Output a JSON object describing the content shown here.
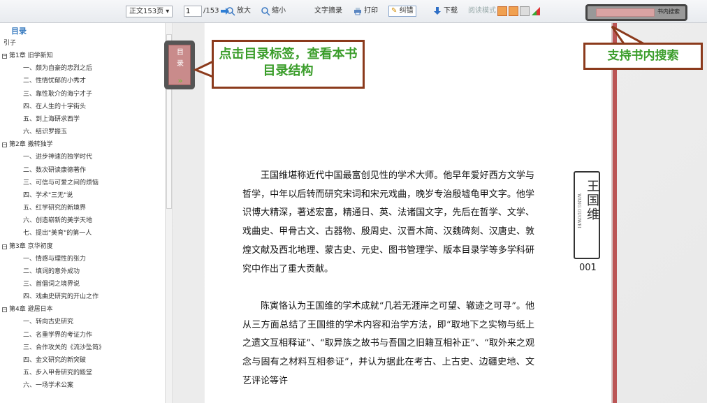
{
  "toolbar": {
    "view_select": "正文153页",
    "page_input": "1",
    "page_total": "/153",
    "zoom_in": "放大",
    "zoom_out": "缩小",
    "text_excerpt": "文字摘录",
    "print": "打印",
    "correct": "纠错",
    "download": "下载",
    "read_mode": "阅读模式",
    "search_button": "书内搜索"
  },
  "sidebar": {
    "title": "目录",
    "items": [
      {
        "level": 0,
        "label": "引子"
      },
      {
        "level": 0,
        "label": "第1章 旧学新知",
        "box": true
      },
      {
        "level": 1,
        "label": "一、颇为自豪的忠烈之后"
      },
      {
        "level": 1,
        "label": "二、性情忧郁的小秀才"
      },
      {
        "level": 1,
        "label": "三、靠性耿介的海宁才子"
      },
      {
        "level": 1,
        "label": "四、在人生的十字街头"
      },
      {
        "level": 1,
        "label": "五、到上海研求西学"
      },
      {
        "level": 1,
        "label": "六、结识罗振玉"
      },
      {
        "level": 0,
        "label": "第2章 撒转独学",
        "box": true
      },
      {
        "level": 1,
        "label": "一、进步神速的独学时代"
      },
      {
        "level": 1,
        "label": "二、数次研读康德著作"
      },
      {
        "level": 1,
        "label": "三、可信与可爱之间的烦恼"
      },
      {
        "level": 1,
        "label": "四、学术\"三无\"说"
      },
      {
        "level": 1,
        "label": "五、红学研究的新境界"
      },
      {
        "level": 1,
        "label": "六、创造崭新的美学天地"
      },
      {
        "level": 1,
        "label": "七、提出\"美育\"的第一人"
      },
      {
        "level": 0,
        "label": "第3章 京华初度",
        "box": true
      },
      {
        "level": 1,
        "label": "一、情感与理性的张力"
      },
      {
        "level": 1,
        "label": "二、填词的意外成功"
      },
      {
        "level": 1,
        "label": "三、首倡词之境界说"
      },
      {
        "level": 1,
        "label": "四、戏曲史研究的开山之作"
      },
      {
        "level": 0,
        "label": "第4章 避居日本",
        "box": true
      },
      {
        "level": 1,
        "label": "一、转向古史研究"
      },
      {
        "level": 1,
        "label": "二、名重学界的考证力作"
      },
      {
        "level": 1,
        "label": "三、合作攻关的《流沙坠简》"
      },
      {
        "level": 1,
        "label": "四、金文研究的新突破"
      },
      {
        "level": 1,
        "label": "五、步入甲骨研究的殿堂"
      },
      {
        "level": 1,
        "label": "六、一场学术公案"
      }
    ]
  },
  "toc_tag": {
    "line1": "目",
    "line2": "录",
    "arrow": "»"
  },
  "callouts": {
    "toc": "点击目录标签，查看本书目录结构",
    "search": "支持书内搜索"
  },
  "page": {
    "para1": "王国维堪称近代中国最富创见性的学术大师。他早年爱好西方文学与哲学，中年以后转而研究宋词和宋元戏曲，晚岁专治殷墟龟甲文字。他学识博大精深，著述宏富，精通日、英、法诸国文字，先后在哲学、文学、戏曲史、甲骨古文、古器物、殷周史、汉晋木简、汉魏碑刻、汉唐史、敦煌文献及西北地理、蒙古史、元史、图书管理学、版本目录学等多学科研究中作出了重大贡献。",
    "para2": "陈寅恪认为王国维的学术成就“几若无涯岸之可望、辙迹之可寻”。他从三方面总结了王国维的学术内容和治学方法，即“取地下之实物与纸上之遗文互相释证”、“取异族之故书与吾国之旧籍互相补正”、“取外来之观念与固有之材料互相参证”，并认为据此在考古、上古史、边疆史地、文艺评论等许",
    "stamp_name": "王国维",
    "stamp_pinyin": "WANG GUOWEI",
    "page_number": "001"
  }
}
